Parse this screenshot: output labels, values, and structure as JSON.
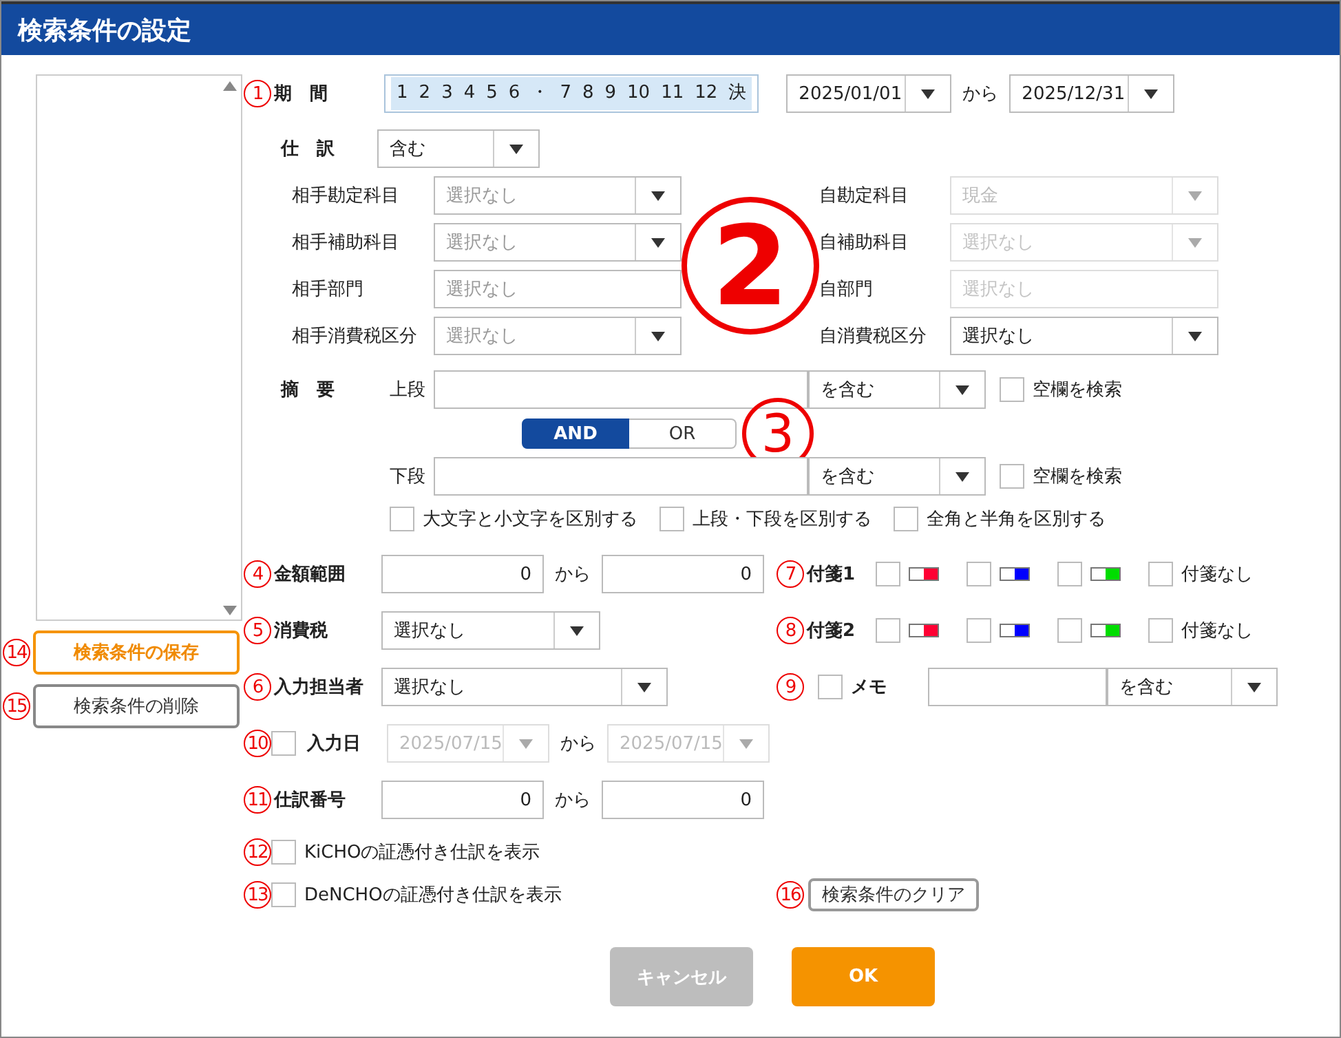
{
  "window": {
    "title": "検索条件の設定"
  },
  "saved_conditions": {
    "save_button": {
      "marker": "14",
      "label": "検索条件の保存",
      "highlighted": true
    },
    "delete_button": {
      "marker": "15",
      "label": "検索条件の削除",
      "highlighted": false
    }
  },
  "period": {
    "marker": "1",
    "label": "期　間",
    "months": [
      {
        "label": "1",
        "selected": true
      },
      {
        "label": "2",
        "selected": true
      },
      {
        "label": "3",
        "selected": true
      },
      {
        "label": "4",
        "selected": true
      },
      {
        "label": "5",
        "selected": true
      },
      {
        "label": "6",
        "selected": true
      },
      {
        "label": "・",
        "selected": true
      },
      {
        "label": "7",
        "selected": true
      },
      {
        "label": "8",
        "selected": true
      },
      {
        "label": "9",
        "selected": true
      },
      {
        "label": "10",
        "selected": true
      },
      {
        "label": "11",
        "selected": true
      },
      {
        "label": "12",
        "selected": true
      },
      {
        "label": "決",
        "selected": true
      }
    ],
    "from": "2025/01/01",
    "separator": "から",
    "to": "2025/12/31"
  },
  "journal": {
    "label": "仕　訳",
    "value": "含む"
  },
  "accounts": {
    "marker": "2",
    "rows": [
      {
        "label": "相手勘定科目",
        "field": {
          "kind": "select",
          "placeholder": "選択なし",
          "disabled": false
        },
        "own_label": "自勘定科目",
        "own_field": {
          "kind": "select",
          "value": "現金",
          "disabled": true
        }
      },
      {
        "label": "相手補助科目",
        "field": {
          "kind": "select",
          "placeholder": "選択なし",
          "disabled": false
        },
        "own_label": "自補助科目",
        "own_field": {
          "kind": "select",
          "placeholder": "選択なし",
          "disabled": true
        }
      },
      {
        "label": "相手部門",
        "field": {
          "kind": "text",
          "placeholder": "選択なし",
          "disabled": false
        },
        "own_label": "自部門",
        "own_field": {
          "kind": "text",
          "placeholder": "選択なし",
          "disabled": true
        }
      },
      {
        "label": "相手消費税区分",
        "field": {
          "kind": "select",
          "placeholder": "選択なし",
          "disabled": false
        },
        "own_label": "自消費税区分",
        "own_field": {
          "kind": "select",
          "value": "選択なし",
          "disabled": false
        }
      }
    ]
  },
  "summary": {
    "label": "摘　要",
    "marker": "3",
    "upper": {
      "label": "上段",
      "match": "を含む",
      "blank_search": {
        "label": "空欄を検索",
        "checked": false
      }
    },
    "logic": [
      {
        "label": "AND",
        "selected": true
      },
      {
        "label": "OR",
        "selected": false
      }
    ],
    "lower": {
      "label": "下段",
      "match": "を含む",
      "blank_search": {
        "label": "空欄を検索",
        "checked": false
      }
    },
    "options": [
      {
        "label": "大文字と小文字を区別する",
        "checked": false
      },
      {
        "label": "上段・下段を区別する",
        "checked": false
      },
      {
        "label": "全角と半角を区別する",
        "checked": false
      }
    ]
  },
  "amount": {
    "marker": "4",
    "label": "金額範囲",
    "from": "0",
    "separator": "から",
    "to": "0"
  },
  "tag1": {
    "marker": "7",
    "label": "付箋1",
    "tags": [
      {
        "color": "#ff0033",
        "checked": false
      },
      {
        "color": "#0000ff",
        "checked": false
      },
      {
        "color": "#00dd00",
        "checked": false
      }
    ],
    "none": {
      "label": "付箋なし",
      "checked": false
    }
  },
  "tax": {
    "marker": "5",
    "label": "消費税",
    "value": "選択なし"
  },
  "tag2": {
    "marker": "8",
    "label": "付箋2",
    "tags": [
      {
        "color": "#ff0033",
        "checked": false
      },
      {
        "color": "#0000ff",
        "checked": false
      },
      {
        "color": "#00dd00",
        "checked": false
      }
    ],
    "none": {
      "label": "付箋なし",
      "checked": false
    }
  },
  "inputter": {
    "marker": "6",
    "label": "入力担当者",
    "value": "選択なし"
  },
  "memo": {
    "marker": "9",
    "checked": false,
    "label": "メモ",
    "match": "を含む"
  },
  "input_date": {
    "marker": "10",
    "checked": false,
    "label": "入力日",
    "from": "2025/07/15",
    "separator": "から",
    "to": "2025/07/15",
    "disabled": true
  },
  "journal_number": {
    "marker": "11",
    "label": "仕訳番号",
    "from": "0",
    "separator": "から",
    "to": "0"
  },
  "evidence": [
    {
      "marker": "12",
      "label": "KiCHOの証憑付き仕訳を表示",
      "checked": false
    },
    {
      "marker": "13",
      "label": "DeNCHOの証憑付き仕訳を表示",
      "checked": false
    }
  ],
  "clear_button": {
    "marker": "16",
    "label": "検索条件のクリア"
  },
  "footer": {
    "buttons": [
      {
        "kind": "cancel",
        "label": "キャンセル"
      },
      {
        "kind": "ok",
        "label": "OK"
      }
    ]
  }
}
